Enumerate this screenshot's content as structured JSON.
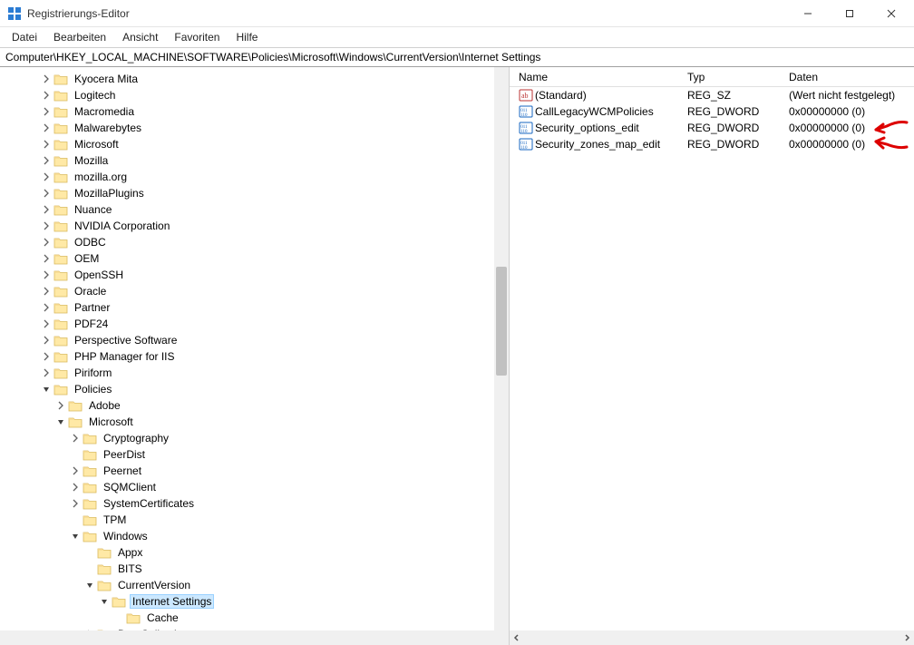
{
  "titlebar": {
    "app_name": "Registrierungs-Editor"
  },
  "menu": {
    "items": [
      "Datei",
      "Bearbeiten",
      "Ansicht",
      "Favoriten",
      "Hilfe"
    ]
  },
  "address": "Computer\\HKEY_LOCAL_MACHINE\\SOFTWARE\\Policies\\Microsoft\\Windows\\CurrentVersion\\Internet Settings",
  "tree": [
    {
      "depth": 3,
      "exp": ">",
      "label": "Kyocera Mita"
    },
    {
      "depth": 3,
      "exp": ">",
      "label": "Logitech"
    },
    {
      "depth": 3,
      "exp": ">",
      "label": "Macromedia"
    },
    {
      "depth": 3,
      "exp": ">",
      "label": "Malwarebytes"
    },
    {
      "depth": 3,
      "exp": ">",
      "label": "Microsoft"
    },
    {
      "depth": 3,
      "exp": ">",
      "label": "Mozilla"
    },
    {
      "depth": 3,
      "exp": ">",
      "label": "mozilla.org"
    },
    {
      "depth": 3,
      "exp": ">",
      "label": "MozillaPlugins"
    },
    {
      "depth": 3,
      "exp": ">",
      "label": "Nuance"
    },
    {
      "depth": 3,
      "exp": ">",
      "label": "NVIDIA Corporation"
    },
    {
      "depth": 3,
      "exp": ">",
      "label": "ODBC"
    },
    {
      "depth": 3,
      "exp": ">",
      "label": "OEM"
    },
    {
      "depth": 3,
      "exp": ">",
      "label": "OpenSSH"
    },
    {
      "depth": 3,
      "exp": ">",
      "label": "Oracle"
    },
    {
      "depth": 3,
      "exp": ">",
      "label": "Partner"
    },
    {
      "depth": 3,
      "exp": ">",
      "label": "PDF24"
    },
    {
      "depth": 3,
      "exp": ">",
      "label": "Perspective Software"
    },
    {
      "depth": 3,
      "exp": ">",
      "label": "PHP Manager for IIS"
    },
    {
      "depth": 3,
      "exp": ">",
      "label": "Piriform"
    },
    {
      "depth": 3,
      "exp": "v",
      "label": "Policies"
    },
    {
      "depth": 4,
      "exp": ">",
      "label": "Adobe"
    },
    {
      "depth": 4,
      "exp": "v",
      "label": "Microsoft"
    },
    {
      "depth": 5,
      "exp": ">",
      "label": "Cryptography"
    },
    {
      "depth": 5,
      "exp": "",
      "label": "PeerDist"
    },
    {
      "depth": 5,
      "exp": ">",
      "label": "Peernet"
    },
    {
      "depth": 5,
      "exp": ">",
      "label": "SQMClient"
    },
    {
      "depth": 5,
      "exp": ">",
      "label": "SystemCertificates"
    },
    {
      "depth": 5,
      "exp": "",
      "label": "TPM"
    },
    {
      "depth": 5,
      "exp": "v",
      "label": "Windows"
    },
    {
      "depth": 6,
      "exp": "",
      "label": "Appx"
    },
    {
      "depth": 6,
      "exp": "",
      "label": "BITS"
    },
    {
      "depth": 6,
      "exp": "v",
      "label": "CurrentVersion"
    },
    {
      "depth": 7,
      "exp": "v",
      "label": "Internet Settings",
      "selected": true
    },
    {
      "depth": 8,
      "exp": "",
      "label": "Cache"
    },
    {
      "depth": 6,
      "exp": ">",
      "label": "DataCollection"
    }
  ],
  "columns": {
    "name": "Name",
    "type": "Typ",
    "data": "Daten"
  },
  "values": [
    {
      "icon": "string",
      "name": "(Standard)",
      "type": "REG_SZ",
      "data": "(Wert nicht festgelegt)"
    },
    {
      "icon": "binary",
      "name": "CallLegacyWCMPolicies",
      "type": "REG_DWORD",
      "data": "0x00000000 (0)"
    },
    {
      "icon": "binary",
      "name": "Security_options_edit",
      "type": "REG_DWORD",
      "data": "0x00000000 (0)",
      "annot": true
    },
    {
      "icon": "binary",
      "name": "Security_zones_map_edit",
      "type": "REG_DWORD",
      "data": "0x00000000 (0)",
      "annot": true
    }
  ]
}
